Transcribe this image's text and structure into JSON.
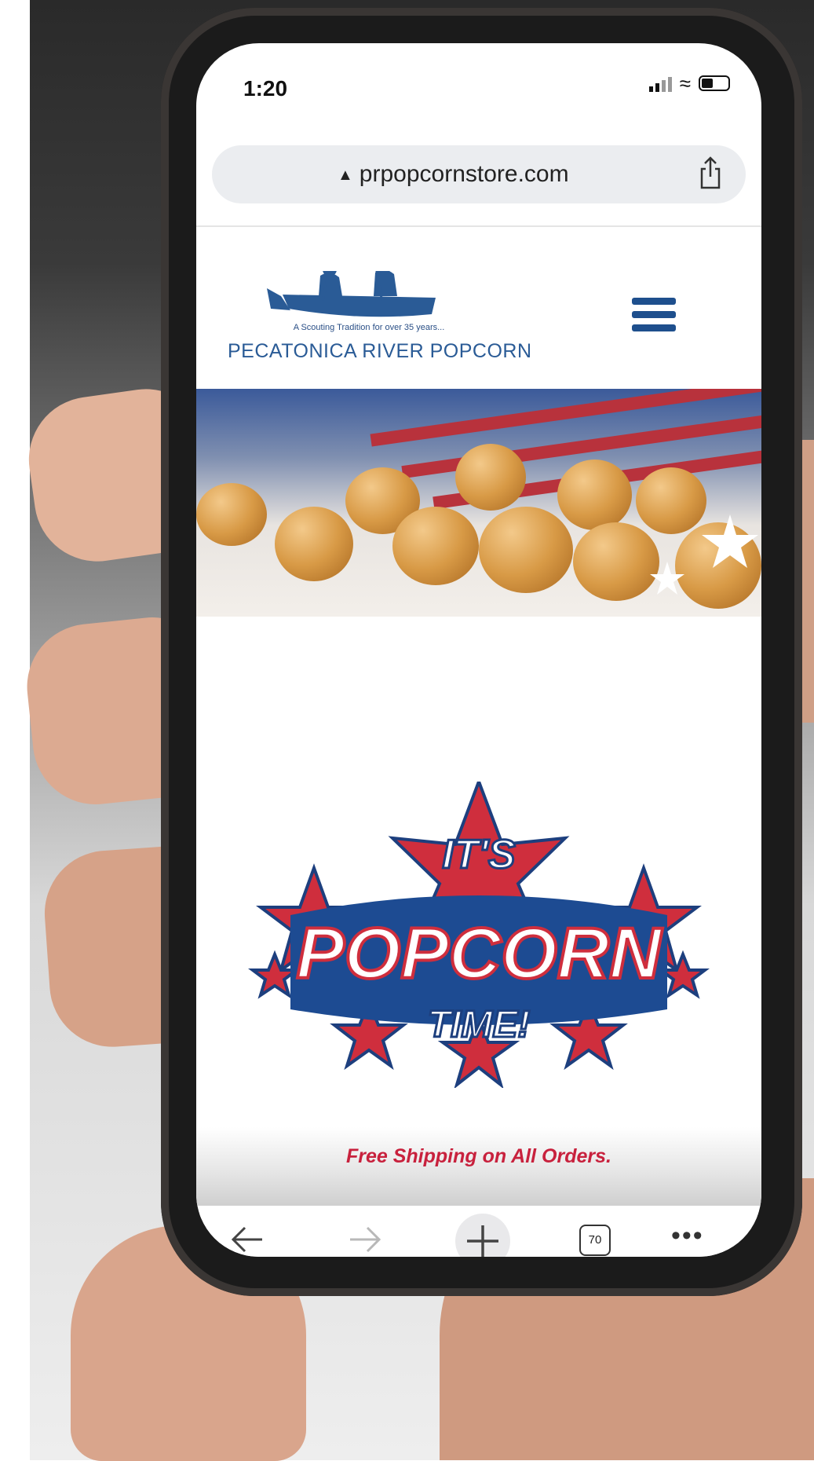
{
  "status_bar": {
    "time": "1:20"
  },
  "browser": {
    "url": "prpopcornstore.com",
    "tab_count": "70"
  },
  "site": {
    "logo_tagline": "A Scouting Tradition for over 35 years...",
    "logo_name": "PECATONICA RIVER POPCORN",
    "badge": {
      "line1": "IT'S",
      "line2": "POPCORN",
      "line3": "TIME!"
    },
    "shipping_notice": "Free Shipping on All Orders."
  },
  "colors": {
    "brand_blue": "#2a5b96",
    "star_red": "#cf2e3d",
    "shipping_red": "#c8213d"
  },
  "icons": {
    "menu": "hamburger-menu-icon",
    "share": "share-icon",
    "back": "arrow-left-icon",
    "forward": "arrow-right-icon",
    "new_tab": "plus-icon",
    "tabs": "tabs-icon",
    "more": "ellipsis-icon",
    "security": "warning-triangle-icon"
  }
}
